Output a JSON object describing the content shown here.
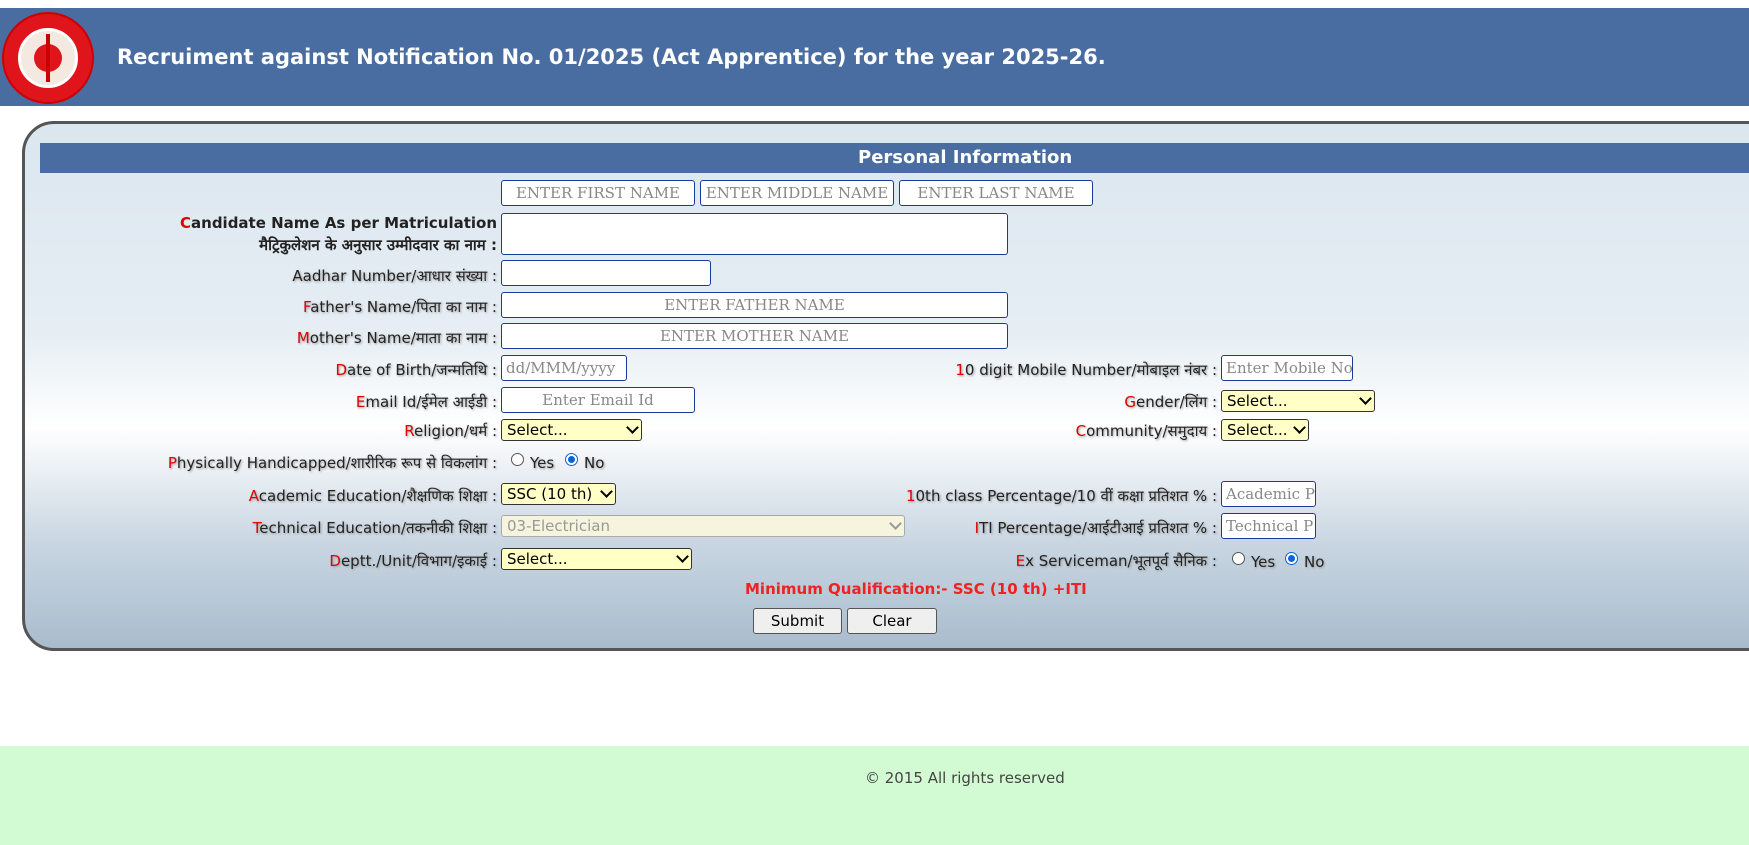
{
  "header": {
    "title": "Recruiment against Notification No. 01/2025 (Act Apprentice) for the year 2025-26."
  },
  "section": {
    "title": "Personal Information"
  },
  "name_fields": {
    "first_placeholder": "ENTER FIRST NAME",
    "middle_placeholder": "ENTER MIDDLE NAME",
    "last_placeholder": "ENTER LAST NAME"
  },
  "labels": {
    "candidate_name_req": "C",
    "candidate_name_rest": "andidate Name As per Matriculation",
    "candidate_name_hindi": "मैट्रिकुलेशन के अनुसार उम्मीदवार का नाम  :",
    "aadhar": "Aadhar Number/आधार संख्या :",
    "father_req": "F",
    "father_rest": "ather's Name/पिता का नाम :",
    "mother_req": "M",
    "mother_rest": "other's Name/माता का नाम :",
    "dob_req": "D",
    "dob_rest": "ate of Birth/जन्मतिथि :",
    "email_req": "E",
    "email_rest": "mail Id/ईमेल आईडी :",
    "religion_req": "R",
    "religion_rest": "eligion/धर्म :",
    "ph_req": "P",
    "ph_rest": "hysically Handicapped/शारीरिक रूप से विकलांग :",
    "academic_req": "A",
    "academic_rest": "cademic Education/शैक्षणिक शिक्षा :",
    "technical_req": "T",
    "technical_rest": "echnical Education/तकनीकी शिक्षा :",
    "dept_req": "D",
    "dept_rest": "eptt./Unit/विभाग/इकाई :",
    "mobile_req": "1",
    "mobile_rest": "0 digit Mobile Number/मोबाइल नंबर :",
    "gender_req": "G",
    "gender_rest": "ender/लिंग :",
    "community_req": "C",
    "community_rest": "ommunity/समुदाय :",
    "tenth_req": "1",
    "tenth_rest": "0th class Percentage/10 वीं कक्षा प्रतिशत % :",
    "iti_req": "I",
    "iti_rest": "TI Percentage/आईटीआई प्रतिशत % :",
    "exs_req": "E",
    "exs_rest": "x Serviceman/भूतपूर्व सैनिक :"
  },
  "inputs": {
    "candidate_name_value": "",
    "aadhar_value": "",
    "father_placeholder": "ENTER FATHER NAME",
    "mother_placeholder": "ENTER MOTHER NAME",
    "dob_placeholder": "dd/MMM/yyyy",
    "email_placeholder": "Enter Email Id",
    "mobile_placeholder": "Enter Mobile No",
    "tenth_placeholder": "Academic P",
    "iti_placeholder": "Technical P"
  },
  "selects": {
    "religion": "Select...",
    "academic": "SSC (10 th)",
    "technical": "03-Electrician",
    "dept": "Select...",
    "gender": "Select...",
    "community": "Select..."
  },
  "radios": {
    "yes_label": "Yes",
    "no_label": "No",
    "ph_selected": "No",
    "exs_selected": "No"
  },
  "min_qualification": "Minimum Qualification:- SSC (10 th) +ITI",
  "buttons": {
    "submit": "Submit",
    "clear": "Clear"
  },
  "footer": {
    "text": "© 2015 All rights reserved"
  },
  "colors": {
    "header_bg": "#4a6da1",
    "required_marker": "#e00000",
    "select_bg": "#ffffc6",
    "footer_bg": "#d3fbd3"
  }
}
